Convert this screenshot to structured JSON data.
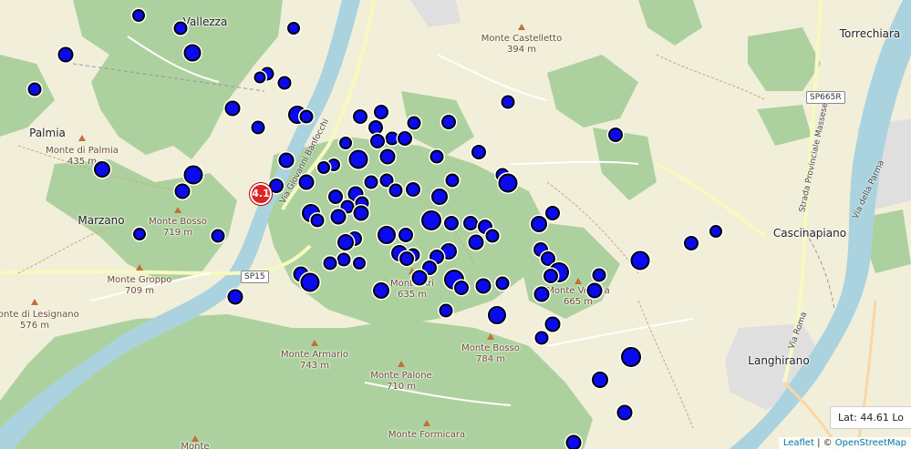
{
  "map": {
    "provider": "Leaflet / OpenStreetMap",
    "colors": {
      "land": "#f1efd9",
      "forest": "#add19e",
      "water": "#aad3df",
      "river": "#8ec5df",
      "marker": "#0a0af0",
      "cluster": "#e02424"
    }
  },
  "places": {
    "vallezza": "Vallezza",
    "torrechiara": "Torrechiara",
    "palmia": "Palmia",
    "marzano": "Marzano",
    "cascinapiano": "Cascinapiano",
    "langhirano": "Langhirano"
  },
  "peaks": {
    "castelletto": {
      "name": "Monte Castelletto",
      "elev": "394 m"
    },
    "palmia": {
      "name": "Monte di Palmia",
      "elev": "435 m"
    },
    "bosso1": {
      "name": "Monte Bosso",
      "elev": "719 m"
    },
    "groppo": {
      "name": "Monte Groppo",
      "elev": "709 m"
    },
    "lesignano": {
      "name": "Monte di Lesignano",
      "elev": "576 m"
    },
    "ari": {
      "name": "Monte Ari",
      "elev": "635 m"
    },
    "vetrola": {
      "name": "Monte Vetrola",
      "elev": "665 m"
    },
    "armario": {
      "name": "Monte Armario",
      "elev": "743 m"
    },
    "palone": {
      "name": "Monte Palone",
      "elev": "710 m"
    },
    "bosso2": {
      "name": "Monte Bosso",
      "elev": "784 m"
    },
    "formicara": {
      "name": "Monte Formicara",
      "elev": ""
    },
    "bottom": {
      "name": "Monte",
      "elev": ""
    }
  },
  "roads": {
    "sp15": "SP15",
    "sp665r": "SP665R",
    "via_banchi": "Via Giovanni Banfocchi",
    "strada_massese": "Strada Provinciale Massese",
    "via_parma": "Via della Parma",
    "via_roma": "Via Roma"
  },
  "cluster": {
    "count": "4.1"
  },
  "coords": {
    "text": "Lat: 44.61 Lo"
  },
  "attribution": {
    "leaflet": "Leaflet",
    "sep": " | © ",
    "osm": "OpenStreetMap"
  }
}
